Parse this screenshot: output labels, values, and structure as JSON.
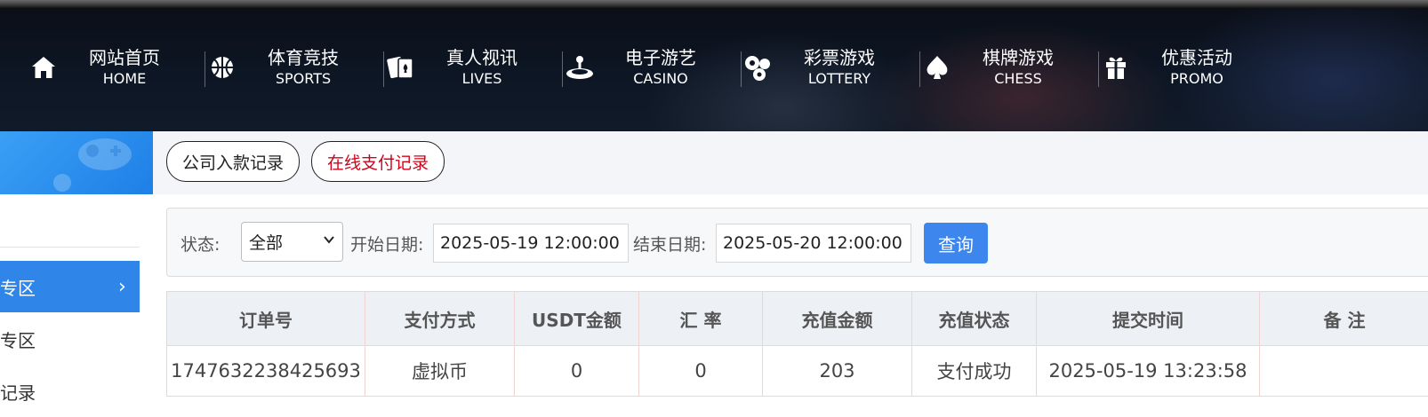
{
  "nav": {
    "items": [
      {
        "zh": "网站首页",
        "en": "HOME",
        "icon": "home-icon"
      },
      {
        "zh": "体育竞技",
        "en": "SPORTS",
        "icon": "basketball-icon"
      },
      {
        "zh": "真人视讯",
        "en": "LIVES",
        "icon": "playing-cards-icon"
      },
      {
        "zh": "电子游艺",
        "en": "CASINO",
        "icon": "joystick-icon"
      },
      {
        "zh": "彩票游戏",
        "en": "LOTTERY",
        "icon": "lottery-balls-icon"
      },
      {
        "zh": "棋牌游戏",
        "en": "CHESS",
        "icon": "spade-icon"
      },
      {
        "zh": "优惠活动",
        "en": "PROMO",
        "icon": "gift-icon"
      }
    ]
  },
  "sidebar": {
    "items": [
      {
        "label": "专区",
        "active": true
      },
      {
        "label": "专区",
        "active": false
      },
      {
        "label": "记录",
        "active": false
      }
    ]
  },
  "tabs": {
    "company_deposit": "公司入款记录",
    "online_payment": "在线支付记录",
    "active_color": "#d0021b"
  },
  "filter": {
    "status_label": "状态:",
    "status_value": "全部",
    "start_label": "开始日期:",
    "start_value": "2025-05-19 12:00:00",
    "end_label": "结束日期:",
    "end_value": "2025-05-20 12:00:00",
    "query_button": "查询",
    "button_color": "#3d86ee"
  },
  "table": {
    "headers": [
      "订单号",
      "支付方式",
      "USDT金额",
      "汇 率",
      "充值金额",
      "充值状态",
      "提交时间",
      "备 注"
    ],
    "rows": [
      [
        "1747632238425693",
        "虚拟币",
        "0",
        "0",
        "203",
        "支付成功",
        "2025-05-19 13:23:58",
        ""
      ]
    ]
  }
}
